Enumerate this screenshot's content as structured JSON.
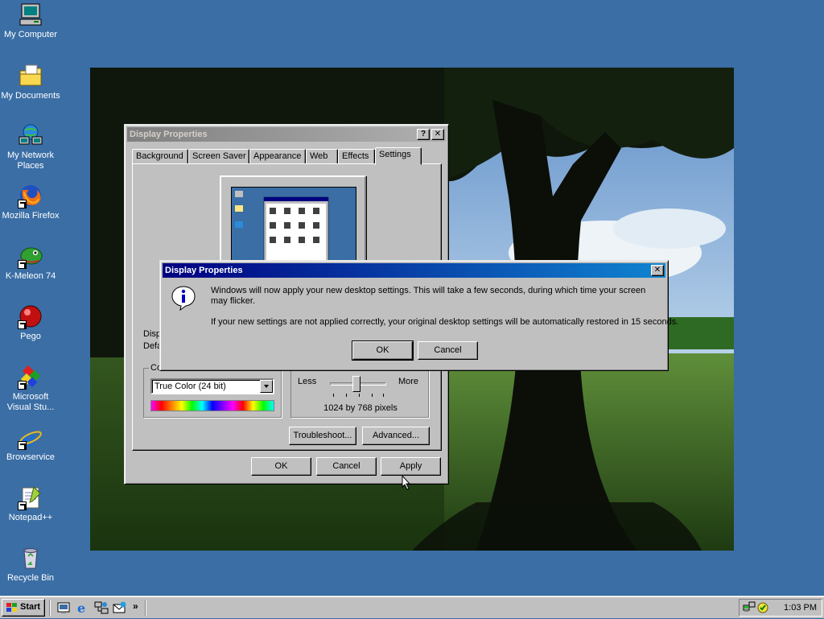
{
  "desktop": {
    "icons": [
      {
        "label": "My Computer"
      },
      {
        "label": "My Documents"
      },
      {
        "label": "My Network Places"
      },
      {
        "label": "Mozilla Firefox"
      },
      {
        "label": "K-Meleon 74"
      },
      {
        "label": "Pego"
      },
      {
        "label": "Microsoft Visual Stu..."
      },
      {
        "label": "Browservice"
      },
      {
        "label": "Notepad++"
      },
      {
        "label": "Recycle Bin"
      }
    ]
  },
  "display_properties": {
    "title": "Display Properties",
    "help_glyph": "?",
    "close_glyph": "✕",
    "tabs": [
      {
        "label": "Background"
      },
      {
        "label": "Screen Saver"
      },
      {
        "label": "Appearance"
      },
      {
        "label": "Web"
      },
      {
        "label": "Effects"
      },
      {
        "label": "Settings",
        "selected": true
      }
    ],
    "display_label_partial": "Disp",
    "default_label_partial": "Defa",
    "colors_group_label_partial": "Co",
    "colors_value": "True Color (24 bit)",
    "slider_less": "Less",
    "slider_more": "More",
    "slider_position": 0.47,
    "resolution_text": "1024 by 768 pixels",
    "troubleshoot_label": "Troubleshoot...",
    "advanced_label": "Advanced...",
    "ok_label": "OK",
    "cancel_label": "Cancel",
    "apply_label": "Apply"
  },
  "message_box": {
    "title": "Display Properties",
    "close_glyph": "✕",
    "icon": "info-icon",
    "line1": "Windows will now apply your new desktop settings. This will take a few seconds, during which time your screen may flicker.",
    "line2": "If your new settings are not applied correctly, your original desktop settings will be automatically restored in 15 seconds.",
    "ok_label": "OK",
    "cancel_label": "Cancel"
  },
  "taskbar": {
    "start_label": "Start",
    "quick_launch": [
      "show-desktop-icon",
      "internet-explorer-icon",
      "network-icon",
      "outlook-express-icon"
    ],
    "chevron": "»",
    "clock": "1:03 PM"
  },
  "colors": {
    "desktop": "#3a6ea5",
    "active_title": "#000080",
    "inactive_title": "#808080",
    "face": "#c0c0c0"
  }
}
